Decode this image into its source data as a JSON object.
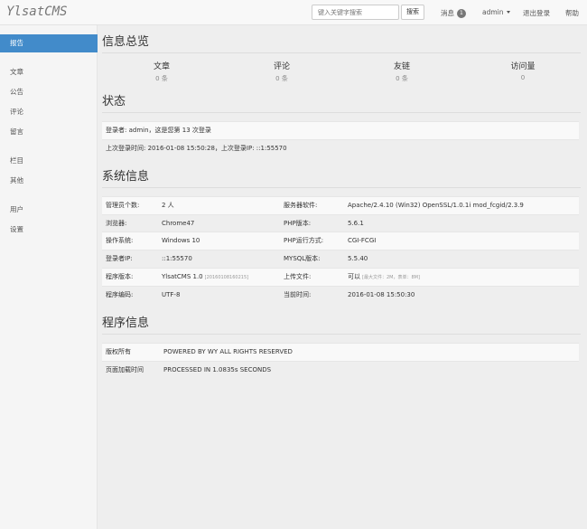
{
  "app": {
    "logo": "YlsatCMS"
  },
  "topbar": {
    "search_placeholder": "键入关键字搜索",
    "search_button": "搜索",
    "messages_label": "消息",
    "messages_count": "1",
    "user": "admin",
    "logout": "退出登录",
    "help": "帮助"
  },
  "sidebar": {
    "items": [
      {
        "label": "报告"
      },
      {
        "label": "文章"
      },
      {
        "label": "公告"
      },
      {
        "label": "评论"
      },
      {
        "label": "留言"
      },
      {
        "label": "栏目"
      },
      {
        "label": "其他"
      },
      {
        "label": "用户"
      },
      {
        "label": "设置"
      }
    ]
  },
  "overview": {
    "title": "信息总览",
    "stats": [
      {
        "label": "文章",
        "value": "0 条"
      },
      {
        "label": "评论",
        "value": "0 条"
      },
      {
        "label": "友链",
        "value": "0 条"
      },
      {
        "label": "访问量",
        "value": "0"
      }
    ]
  },
  "status": {
    "title": "状态",
    "line1": "登录者: admin，这是您第 13 次登录",
    "line2": "上次登录时间: 2016-01-08 15:50:28，上次登录IP: ::1:55570"
  },
  "sysinfo": {
    "title": "系统信息",
    "rows": [
      {
        "l1": "管理员个数:",
        "v1": "2 人",
        "l2": "服务器软件:",
        "v2": "Apache/2.4.10 (Win32) OpenSSL/1.0.1i mod_fcgid/2.3.9"
      },
      {
        "l1": "浏览器:",
        "v1": "Chrome47",
        "l2": "PHP版本:",
        "v2": "5.6.1"
      },
      {
        "l1": "操作系统:",
        "v1": "Windows 10",
        "l2": "PHP运行方式:",
        "v2": "CGI-FCGI"
      },
      {
        "l1": "登录者IP:",
        "v1": "::1:55570",
        "l2": "MYSQL版本:",
        "v2": "5.5.40"
      },
      {
        "l1": "程序版本:",
        "v1": "YlsatCMS 1.0",
        "v1_small": "[20160108160215]",
        "l2": "上传文件:",
        "v2": "可以",
        "v2_small": "[最大文件：2M，表单：8M]"
      },
      {
        "l1": "程序编码:",
        "v1": "UTF-8",
        "l2": "当前时间:",
        "v2": "2016-01-08 15:50:30"
      }
    ]
  },
  "program": {
    "title": "程序信息",
    "rows": [
      {
        "label": "版权所有",
        "value": "POWERED BY WY ALL RIGHTS RESERVED"
      },
      {
        "label": "页面加载时间",
        "value": "PROCESSED IN 1.0835s SECONDS"
      }
    ]
  }
}
